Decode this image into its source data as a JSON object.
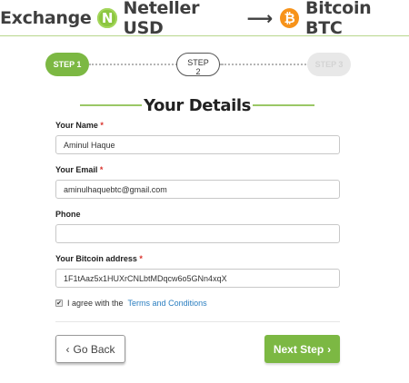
{
  "header": {
    "exchange_label": "Exchange",
    "from_icon_letter": "N",
    "from_label": "Neteller USD",
    "arrow": "⟶",
    "to_icon_letter": "₿",
    "to_label": "Bitcoin BTC"
  },
  "steps": {
    "step1": "STEP 1",
    "step2_line1": "STEP",
    "step2_line2": "2",
    "step3": "STEP 3"
  },
  "section_title": "Your Details",
  "form": {
    "name_label": "Your Name",
    "name_value": "Aminul Haque",
    "email_label": "Your Email",
    "email_value": "aminulhaquebtc@gmail.com",
    "phone_label": "Phone",
    "phone_value": "",
    "btc_label": "Your Bitcoin address",
    "btc_value": "1F1tAaz5x1HUXrCNLbtMDqcw6o5GNn4xqX",
    "required_mark": "*"
  },
  "agree": {
    "checked": true,
    "check_glyph": "✔",
    "prefix": "I agree with the",
    "link_text": "Terms and Conditions"
  },
  "buttons": {
    "back_label": "Go Back",
    "back_icon": "‹",
    "next_label": "Next Step",
    "next_icon": "›"
  },
  "colors": {
    "accent_green": "#7cb843",
    "bitcoin_orange": "#f7931a",
    "link_blue": "#2a7ec0",
    "required_red": "#d9312b"
  }
}
